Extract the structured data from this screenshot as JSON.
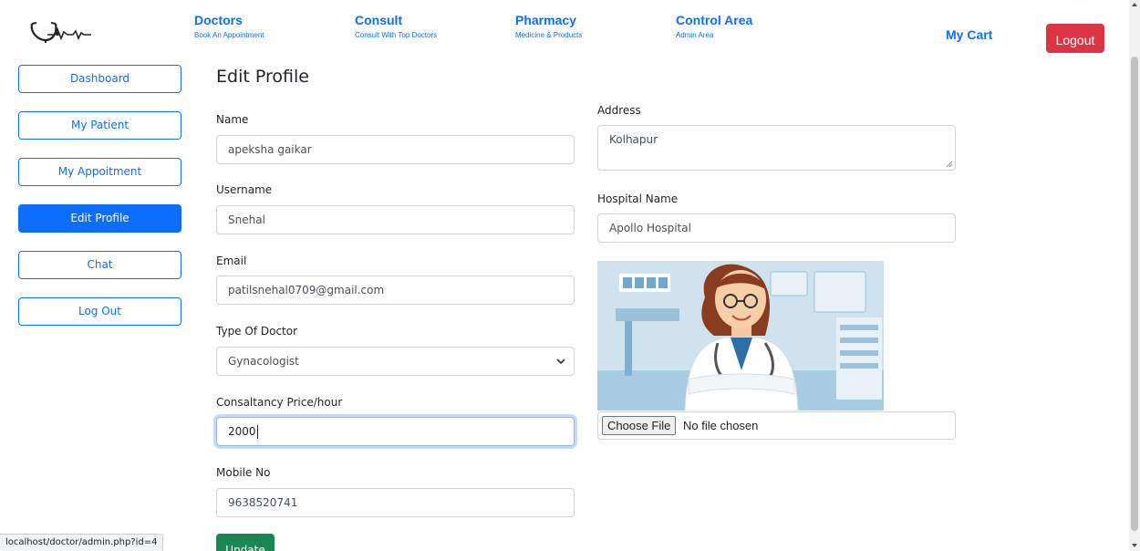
{
  "nav": {
    "items": [
      {
        "title": "Doctors",
        "subtitle": "Book An Appointment"
      },
      {
        "title": "Consult",
        "subtitle": "Consult With Top Doctors"
      },
      {
        "title": "Pharmacy",
        "subtitle": "Medicine & Products"
      },
      {
        "title": "Control Area",
        "subtitle": "Admin Area"
      }
    ],
    "cart_label": "My Cart",
    "logout_label": "Logout",
    "logo_icon": "stethoscope-heartbeat-logo"
  },
  "sidebar": {
    "items": [
      {
        "label": "Dashboard",
        "active": false
      },
      {
        "label": "My Patient",
        "active": false
      },
      {
        "label": "My Appoitment",
        "active": false
      },
      {
        "label": "Edit Profile",
        "active": true
      },
      {
        "label": "Chat",
        "active": false
      },
      {
        "label": "Log Out",
        "active": false
      }
    ]
  },
  "form": {
    "title": "Edit Profile",
    "name": {
      "label": "Name",
      "value": "apeksha gaikar"
    },
    "username": {
      "label": "Username",
      "value": "Snehal"
    },
    "email": {
      "label": "Email",
      "value": "patilsnehal0709@gmail.com"
    },
    "doctor_type": {
      "label": "Type Of Doctor",
      "value": "Gynacologist"
    },
    "price": {
      "label": "Consaltancy Price/hour",
      "value": "2000"
    },
    "mobile": {
      "label": "Mobile No",
      "value": "9638520741"
    },
    "address": {
      "label": "Address",
      "value": "Kolhapur"
    },
    "hospital": {
      "label": "Hospital Name",
      "value": "Apollo Hospital"
    },
    "photo_icon": "doctor-illustration",
    "file": {
      "button_label": "Choose File",
      "status": "No file chosen"
    },
    "update_label": "Update"
  },
  "status_url": "localhost/doctor/admin.php?id=4",
  "colors": {
    "primary": "#0d6efd",
    "danger": "#dc3545",
    "success": "#198754"
  }
}
